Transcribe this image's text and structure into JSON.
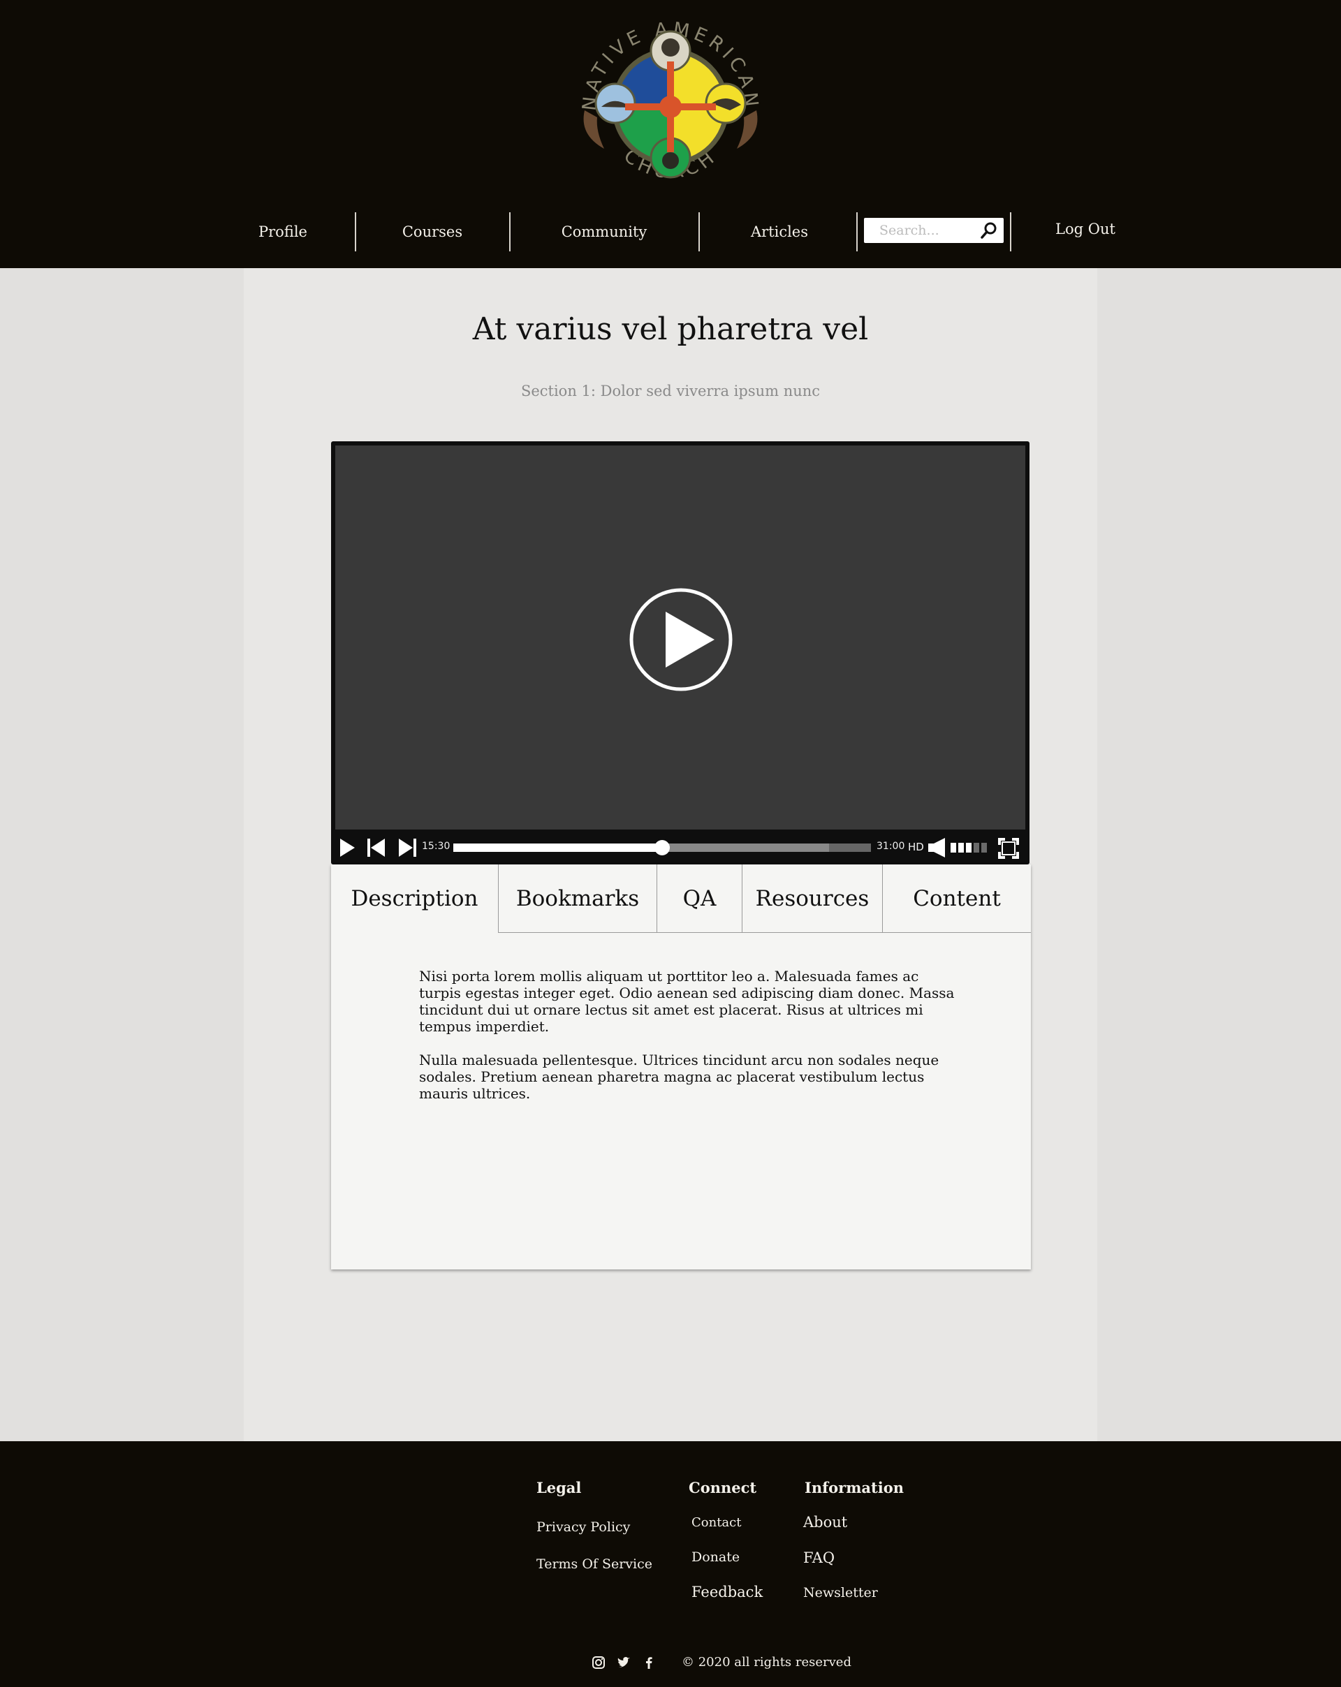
{
  "header": {
    "logo": {
      "top_text": "NATIVE AMERICAN",
      "bottom_text": "CHURCH"
    },
    "nav": {
      "profile": "Profile",
      "courses": "Courses",
      "community": "Community",
      "articles": "Articles",
      "logout": "Log Out"
    },
    "search": {
      "placeholder": "Search...",
      "icon": "search-icon"
    }
  },
  "main": {
    "title": "At varius vel pharetra vel",
    "section": "Section 1: Dolor sed viverra ipsum nunc"
  },
  "player": {
    "current_time": "15:30",
    "duration": "31:00",
    "quality": "HD",
    "progress": 0.5,
    "buffered": 0.9,
    "volume_bars": 3,
    "icons": [
      "play-icon",
      "previous-icon",
      "next-icon",
      "volume-icon",
      "fullscreen-icon"
    ]
  },
  "tabs": [
    "Description",
    "Bookmarks",
    "QA",
    "Resources",
    "Content"
  ],
  "active_tab": "Description",
  "description": {
    "paragraph1": "Nisi porta lorem mollis aliquam ut porttitor leo a. Malesuada fames ac turpis egestas integer eget. Odio aenean sed adipiscing diam donec. Massa tincidunt dui ut ornare lectus sit amet est placerat. Risus at ultrices mi tempus imperdiet.",
    "paragraph2": "Nulla malesuada pellentesque. Ultrices tincidunt arcu non sodales neque sodales. Pretium aenean pharetra magna ac placerat vestibulum lectus mauris ultrices."
  },
  "footer": {
    "legal": {
      "heading": "Legal",
      "privacy": "Privacy Policy",
      "terms": "Terms Of Service"
    },
    "connect": {
      "heading": "Connect",
      "contact": "Contact",
      "donate": "Donate",
      "feedback": "Feedback"
    },
    "information": {
      "heading": "Information",
      "about": "About",
      "faq": "FAQ",
      "newsletter": "Newsletter"
    },
    "social_icons": [
      "instagram-icon",
      "twitter-icon",
      "facebook-icon"
    ],
    "copyright": "© 2020 all rights reserved"
  },
  "colors": {
    "header_bg": "#0e0b05",
    "main_bg": "#e8e7e5",
    "page_bg": "#e1e0de",
    "player_screen": "#393939",
    "logo_blue": "#1f4d9a",
    "logo_yellow": "#f3df2a",
    "logo_green": "#1ea04a",
    "logo_center": "#d9542a"
  }
}
